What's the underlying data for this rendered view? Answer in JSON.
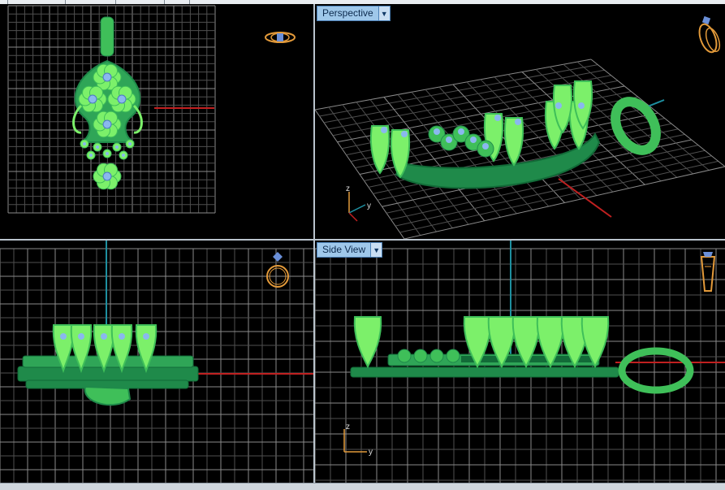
{
  "viewports": {
    "top": {
      "label": ""
    },
    "perspective": {
      "label": "Perspective",
      "dropdown_icon": "chevron-down-icon"
    },
    "front": {
      "label": ""
    },
    "side": {
      "label": "Side View",
      "dropdown_icon": "chevron-down-icon"
    }
  },
  "axes": {
    "z": "z",
    "y": "y"
  },
  "colors": {
    "viewport_bg": "#000000",
    "grid": "#4f4f4f",
    "grid_major": "#8a8a8a",
    "axis_red": "#c02020",
    "axis_blue": "#1e8fa0",
    "model_light": "#7cf06a",
    "model_mid": "#3fbf59",
    "model_dark": "#1f8a4a",
    "gem": "#8ab8ee",
    "view_cube": "#e39a3a"
  }
}
